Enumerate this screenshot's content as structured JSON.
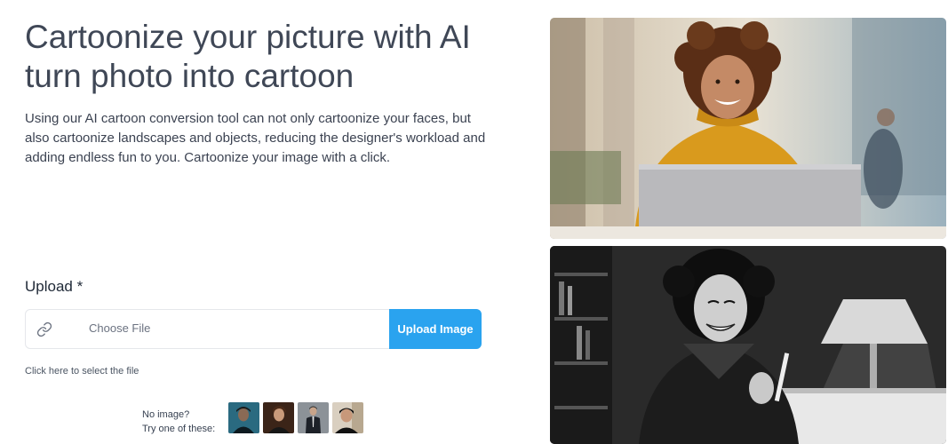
{
  "hero": {
    "title_line1": "Cartoonize your picture with AI",
    "title_line2": "turn photo into cartoon",
    "description": "Using our AI cartoon conversion tool can not only cartoonize your faces, but also cartoonize landscapes and objects, reducing the designer's workload and adding endless fun to you. Cartoonize your image with a click."
  },
  "upload": {
    "label": "Upload *",
    "choose_file": "Choose File",
    "button": "Upload Image",
    "hint": "Click here to select the file",
    "accent_color": "#2aa3ef"
  },
  "samples": {
    "line1": "No image?",
    "line2": "Try one of these:"
  }
}
